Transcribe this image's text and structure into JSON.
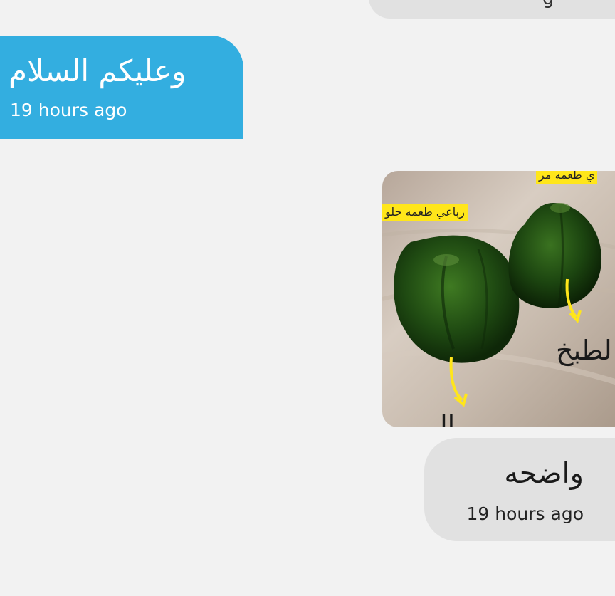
{
  "messages": {
    "top_partial": {
      "time_fragment": "g"
    },
    "sent": {
      "text": "وعليكم السلام",
      "time": "19 hours ago"
    },
    "image": {
      "caption_left": "رباعي طعمه حلو",
      "caption_right": "ي طعمه مر",
      "label_right": "لطبخ",
      "label_bottom": "ال"
    },
    "received": {
      "text": "واضحه",
      "time": "19 hours ago"
    }
  },
  "colors": {
    "sent_bubble": "#33aee0",
    "received_bubble": "#e1e1e1",
    "background": "#f2f2f2"
  }
}
